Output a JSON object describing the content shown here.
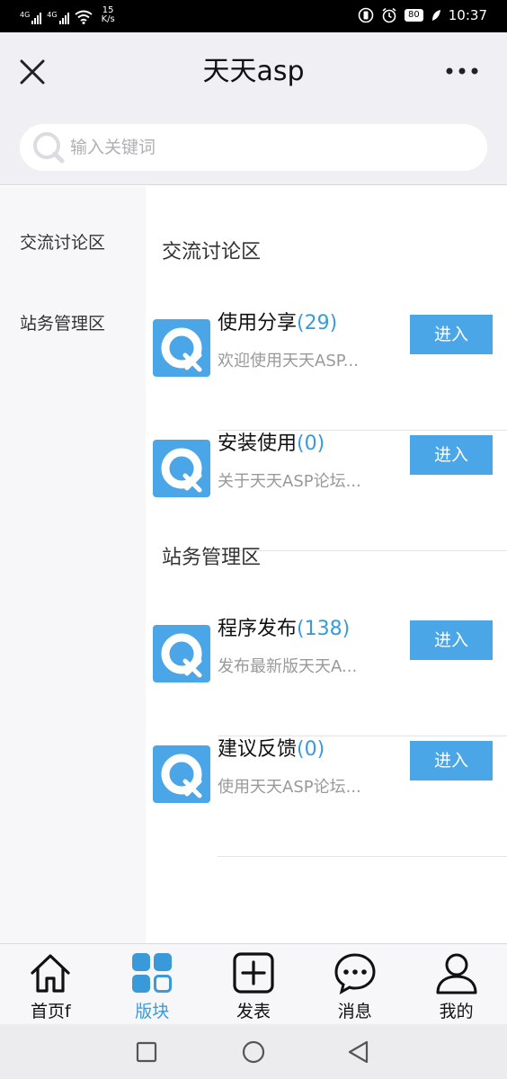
{
  "status_bar": {
    "net1": "4G",
    "net2": "4G",
    "speed_value": "15",
    "speed_unit": "K/s",
    "battery": "80",
    "time": "10:37"
  },
  "header": {
    "title": "天天asp"
  },
  "search": {
    "placeholder": "输入关键词"
  },
  "sidebar": {
    "items": [
      "交流讨论区",
      "站务管理区"
    ]
  },
  "sections": [
    {
      "title": "交流讨论区",
      "forums": [
        {
          "name": "使用分享",
          "count": "(29)",
          "desc": "欢迎使用天天ASP...",
          "button": "进入"
        },
        {
          "name": "安装使用",
          "count": "(0)",
          "desc": "关于天天ASP论坛...",
          "button": "进入"
        }
      ]
    },
    {
      "title": "站务管理区",
      "forums": [
        {
          "name": "程序发布",
          "count": "(138)",
          "desc": "发布最新版天天A...",
          "button": "进入"
        },
        {
          "name": "建议反馈",
          "count": "(0)",
          "desc": "使用天天ASP论坛...",
          "button": "进入"
        }
      ]
    }
  ],
  "bottom_nav": {
    "items": [
      {
        "label": "首页f",
        "icon": "home-icon"
      },
      {
        "label": "版块",
        "icon": "grid-icon"
      },
      {
        "label": "发表",
        "icon": "add-post-icon"
      },
      {
        "label": "消息",
        "icon": "message-icon"
      },
      {
        "label": "我的",
        "icon": "user-icon"
      }
    ],
    "active_index": 1
  },
  "colors": {
    "accent": "#4aa6e6",
    "count_blue": "#3a9ad9",
    "header_bg": "#efeff4"
  }
}
